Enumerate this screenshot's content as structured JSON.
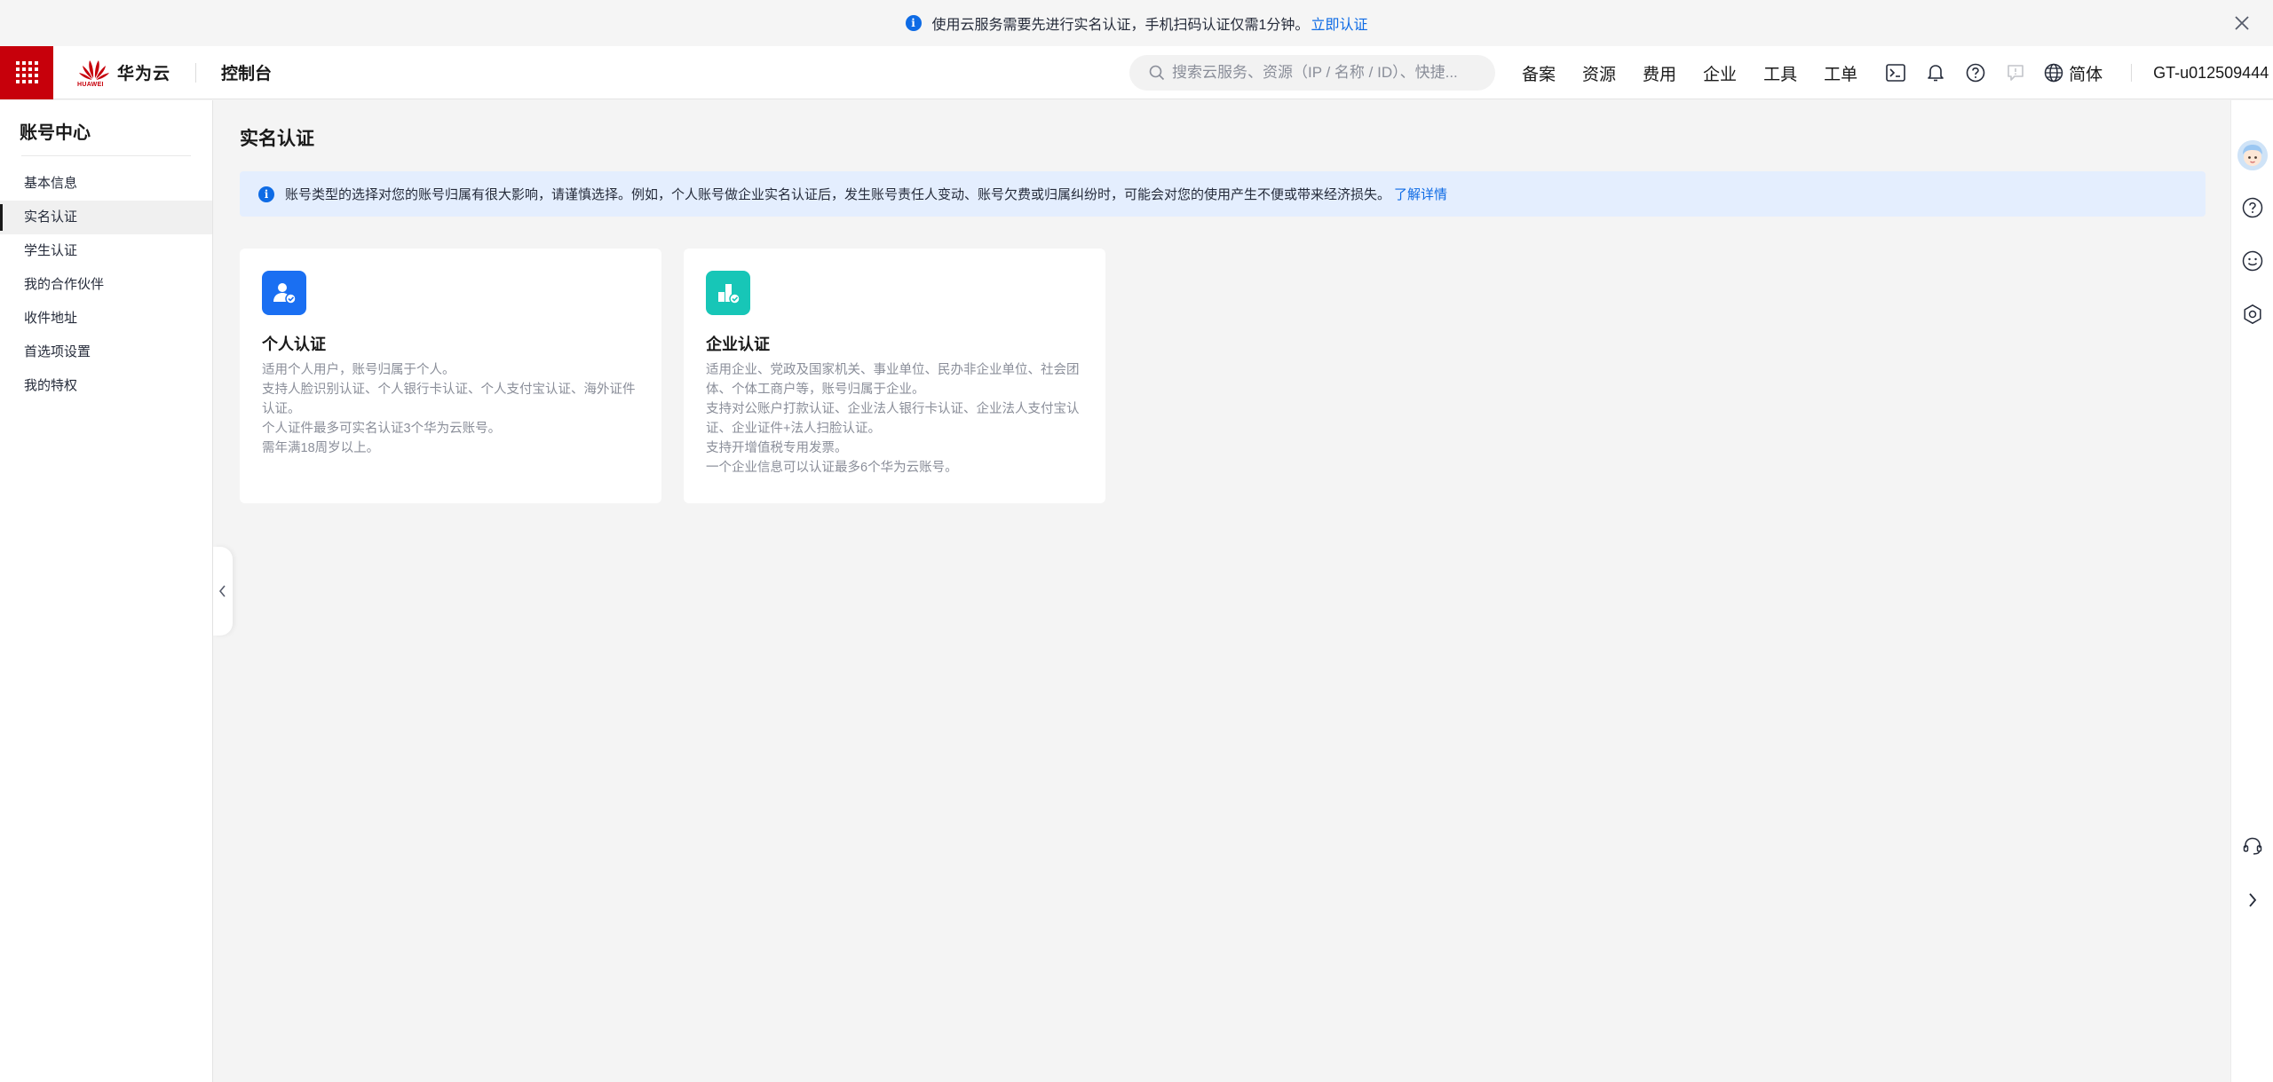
{
  "notice": {
    "text": "使用云服务需要先进行实名认证，手机扫码认证仅需1分钟。",
    "link": "立即认证"
  },
  "header": {
    "brand": "华为云",
    "brand_sub": "HUAWEI",
    "console": "控制台",
    "search_placeholder": "搜索云服务、资源（IP / 名称 / ID）、快捷...",
    "nav": [
      "备案",
      "资源",
      "费用",
      "企业",
      "工具",
      "工单"
    ],
    "lang": "简体",
    "user": "GT-u012509444"
  },
  "sidebar": {
    "title": "账号中心",
    "items": [
      {
        "label": "基本信息"
      },
      {
        "label": "实名认证"
      },
      {
        "label": "学生认证"
      },
      {
        "label": "我的合作伙伴"
      },
      {
        "label": "收件地址"
      },
      {
        "label": "首选项设置"
      },
      {
        "label": "我的特权"
      }
    ],
    "active_index": 1
  },
  "main": {
    "title": "实名认证",
    "alert": {
      "text": "账号类型的选择对您的账号归属有很大影响，请谨慎选择。例如，个人账号做企业实名认证后，发生账号责任人变动、账号欠费或归属纠纷时，可能会对您的使用产生不便或带来经济损失。",
      "link": "了解详情"
    },
    "cards": [
      {
        "title": "个人认证",
        "icon": "personal-verify-icon",
        "color": "#1a6ff2",
        "lines": [
          "适用个人用户，账号归属于个人。",
          "支持人脸识别认证、个人银行卡认证、个人支付宝认证、海外证件认证。",
          "个人证件最多可实名认证3个华为云账号。",
          "需年满18周岁以上。"
        ]
      },
      {
        "title": "企业认证",
        "icon": "enterprise-verify-icon",
        "color": "#17c6b7",
        "lines": [
          "适用企业、党政及国家机关、事业单位、民办非企业单位、社会团体、个体工商户等，账号归属于企业。",
          "支持对公账户打款认证、企业法人银行卡认证、企业法人支付宝认证、企业证件+法人扫脸认证。",
          "支持开增值税专用发票。",
          "一个企业信息可以认证最多6个华为云账号。"
        ]
      }
    ]
  },
  "colors": {
    "brand_red": "#c7000b",
    "link_blue": "#0e6be5",
    "alert_bg": "#e4eefe"
  }
}
